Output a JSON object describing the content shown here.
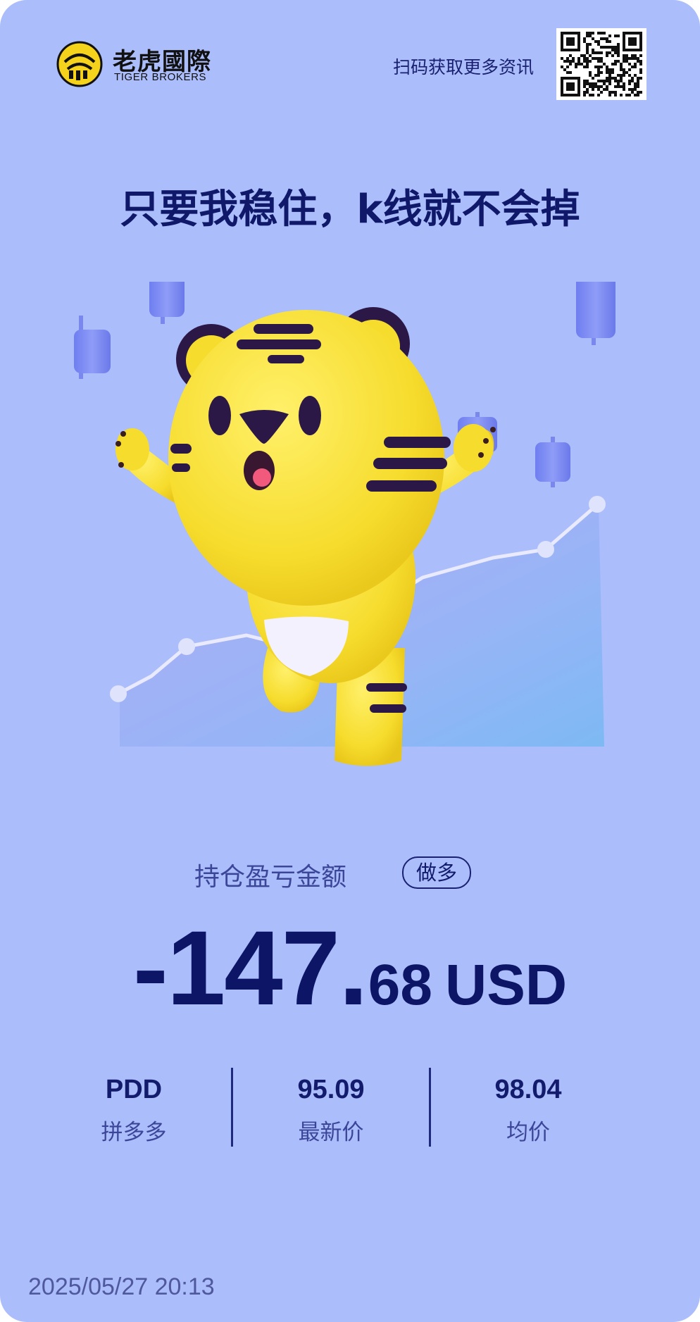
{
  "header": {
    "brand_cn": "老虎國際",
    "brand_en": "TIGER BROKERS",
    "scan_text": "扫码获取更多资讯",
    "logo_icon": "tiger-logo-icon",
    "qr_icon": "qr-code-icon"
  },
  "slogan": "只要我稳住，k线就不会掉",
  "illustration": {
    "icon": "tiger-mascot-icon",
    "chart_icon": "stock-chart-icon"
  },
  "position": {
    "label": "持仓盈亏金额",
    "direction_badge": "做多",
    "amount_integer": "-147",
    "amount_dot": ".",
    "amount_decimal": "68",
    "currency": "USD"
  },
  "stats": [
    {
      "value": "PDD",
      "label": "拼多多"
    },
    {
      "value": "95.09",
      "label": "最新价"
    },
    {
      "value": "98.04",
      "label": "均价"
    }
  ],
  "timestamp": "2025/05/27 20:13",
  "colors": {
    "background": "#abbdfb",
    "text_primary": "#121a6b",
    "text_secondary": "#3c4699",
    "tiger_yellow": "#f9e232",
    "tiger_stripe": "#2b1847"
  }
}
